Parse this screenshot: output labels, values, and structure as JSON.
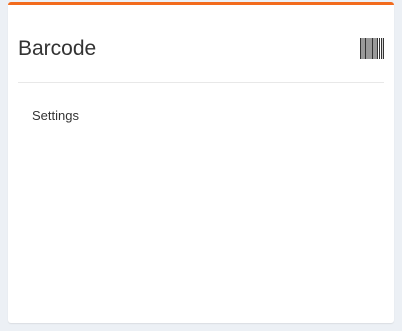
{
  "card": {
    "title": "Barcode",
    "icon": "barcode-icon",
    "settings_label": "Settings"
  },
  "colors": {
    "accent": "#f26b1d",
    "background": "#ecf0f5",
    "card": "#ffffff",
    "text": "#333333"
  }
}
